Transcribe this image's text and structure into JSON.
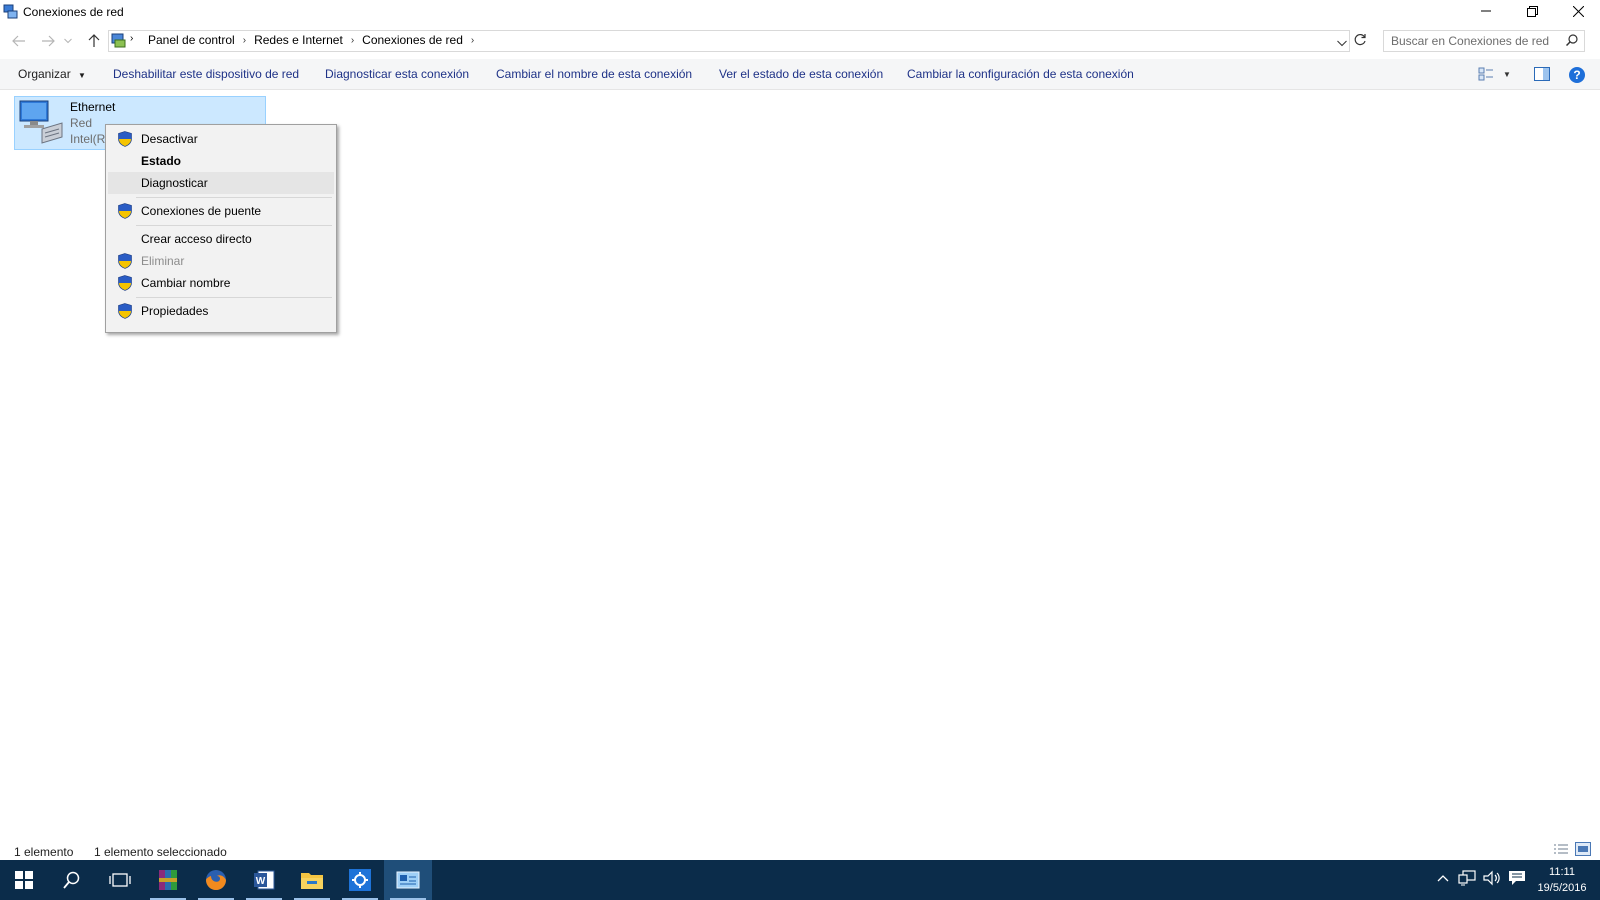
{
  "window": {
    "title": "Conexiones de red"
  },
  "breadcrumb": [
    "Panel de control",
    "Redes e Internet",
    "Conexiones de red"
  ],
  "search": {
    "placeholder": "Buscar en Conexiones de red"
  },
  "commands": {
    "organize": "Organizar",
    "disable_device": "Deshabilitar este dispositivo de red",
    "diagnose": "Diagnosticar esta conexión",
    "rename": "Cambiar el nombre de esta conexión",
    "view_status": "Ver el estado de esta conexión",
    "change_settings": "Cambiar la configuración de esta conexión"
  },
  "item": {
    "name": "Ethernet",
    "network": "Red",
    "adapter": "Intel(R"
  },
  "context_menu": {
    "deactivate": "Desactivar",
    "status": "Estado",
    "diagnose": "Diagnosticar",
    "bridge": "Conexiones de puente",
    "shortcut": "Crear acceso directo",
    "delete": "Eliminar",
    "rename": "Cambiar nombre",
    "properties": "Propiedades"
  },
  "status_bar": {
    "count": "1 elemento",
    "selected": "1 elemento seleccionado"
  },
  "taskbar": {
    "time": "11:11",
    "date": "19/5/2016"
  },
  "colors": {
    "selection": "#cce8ff",
    "link": "#1e3287",
    "taskbar": "#0b2c4a",
    "shield_blue": "#2a5cc4",
    "shield_yellow": "#f5c400"
  }
}
